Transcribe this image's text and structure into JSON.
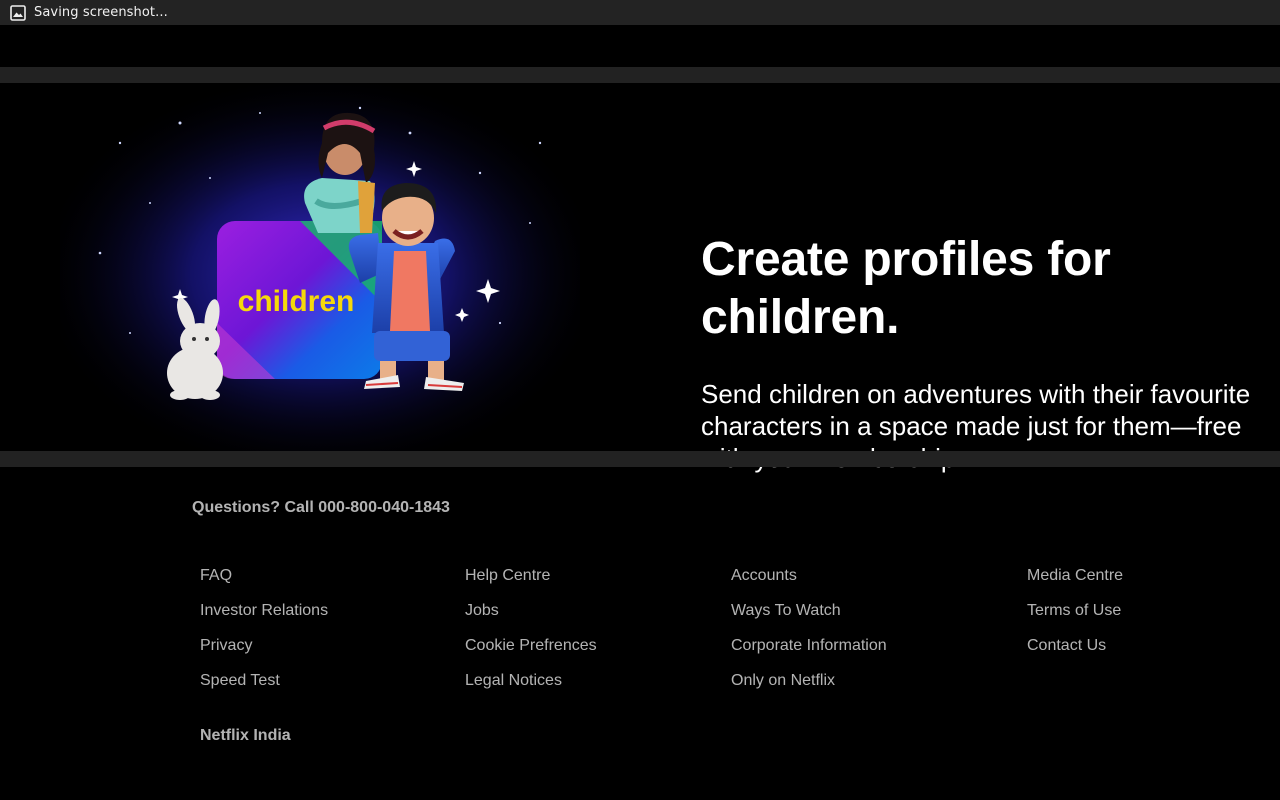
{
  "status_bar": {
    "text": "Saving screenshot...",
    "icon": "image-icon"
  },
  "feature": {
    "title": "Create profiles for children.",
    "description": "Send children on adventures with their favourite characters in a space made just for them—free with your membership.",
    "art_label": "children",
    "colors": {
      "accent_yellow": "#f5d90a",
      "blue": "#1b6fd6",
      "purple": "#7a2ae0"
    }
  },
  "footer": {
    "phone": "Questions? Call 000-800-040-1843",
    "columns": [
      [
        "FAQ",
        "Investor Relations",
        "Privacy",
        "Speed Test"
      ],
      [
        "Help Centre",
        "Jobs",
        "Cookie Prefrences",
        "Legal Notices"
      ],
      [
        "Accounts",
        "Ways To Watch",
        "Corporate Information",
        "Only on Netflix"
      ],
      [
        "Media Centre",
        "Terms of Use",
        "Contact Us"
      ]
    ],
    "country": "Netflix India"
  }
}
